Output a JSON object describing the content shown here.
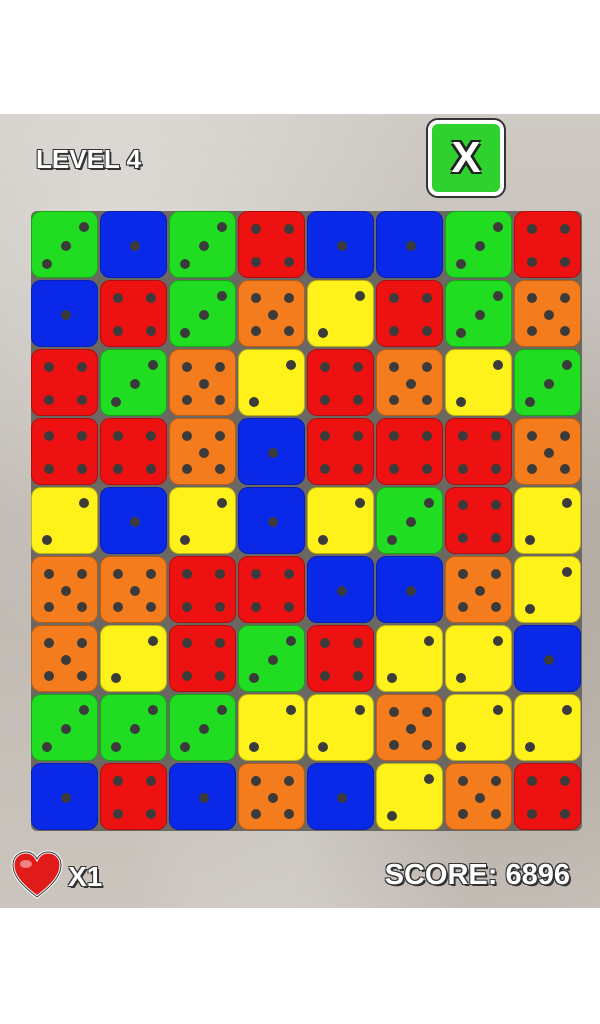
{
  "hud": {
    "level_label": "LEVEL 4",
    "close_label": "X",
    "lives_label": "X1",
    "score_label": "SCORE: 6896"
  },
  "colors": {
    "green": "#21dd21",
    "blue": "#0a28e8",
    "red": "#ee1111",
    "orange": "#f47c1c",
    "yellow": "#fff11a",
    "pip": "#3b3b3b",
    "heart": "#e11a1a"
  },
  "board": {
    "columns": 8,
    "rows": 9,
    "dice": [
      [
        {
          "color": "green",
          "value": 3
        },
        {
          "color": "blue",
          "value": 1
        },
        {
          "color": "green",
          "value": 3
        },
        {
          "color": "red",
          "value": 4
        },
        {
          "color": "blue",
          "value": 1
        },
        {
          "color": "blue",
          "value": 1
        },
        {
          "color": "green",
          "value": 3
        },
        {
          "color": "red",
          "value": 4
        }
      ],
      [
        {
          "color": "blue",
          "value": 1
        },
        {
          "color": "red",
          "value": 4
        },
        {
          "color": "green",
          "value": 3
        },
        {
          "color": "orange",
          "value": 5
        },
        {
          "color": "yellow",
          "value": 2
        },
        {
          "color": "red",
          "value": 4
        },
        {
          "color": "green",
          "value": 3
        },
        {
          "color": "orange",
          "value": 5
        }
      ],
      [
        {
          "color": "red",
          "value": 4
        },
        {
          "color": "green",
          "value": 3
        },
        {
          "color": "orange",
          "value": 5
        },
        {
          "color": "yellow",
          "value": 2
        },
        {
          "color": "red",
          "value": 4
        },
        {
          "color": "orange",
          "value": 5
        },
        {
          "color": "yellow",
          "value": 2
        },
        {
          "color": "green",
          "value": 3
        }
      ],
      [
        {
          "color": "red",
          "value": 4
        },
        {
          "color": "red",
          "value": 4
        },
        {
          "color": "orange",
          "value": 5
        },
        {
          "color": "blue",
          "value": 1
        },
        {
          "color": "red",
          "value": 4
        },
        {
          "color": "red",
          "value": 4
        },
        {
          "color": "red",
          "value": 4
        },
        {
          "color": "orange",
          "value": 5
        }
      ],
      [
        {
          "color": "yellow",
          "value": 2
        },
        {
          "color": "blue",
          "value": 1
        },
        {
          "color": "yellow",
          "value": 2
        },
        {
          "color": "blue",
          "value": 1
        },
        {
          "color": "yellow",
          "value": 2
        },
        {
          "color": "green",
          "value": 3
        },
        {
          "color": "red",
          "value": 4
        },
        {
          "color": "yellow",
          "value": 2
        }
      ],
      [
        {
          "color": "orange",
          "value": 5
        },
        {
          "color": "orange",
          "value": 5
        },
        {
          "color": "red",
          "value": 4
        },
        {
          "color": "red",
          "value": 4
        },
        {
          "color": "blue",
          "value": 1
        },
        {
          "color": "blue",
          "value": 1
        },
        {
          "color": "orange",
          "value": 5
        },
        {
          "color": "yellow",
          "value": 2
        }
      ],
      [
        {
          "color": "orange",
          "value": 5
        },
        {
          "color": "yellow",
          "value": 2
        },
        {
          "color": "red",
          "value": 4
        },
        {
          "color": "green",
          "value": 3
        },
        {
          "color": "red",
          "value": 4
        },
        {
          "color": "yellow",
          "value": 2
        },
        {
          "color": "yellow",
          "value": 2
        },
        {
          "color": "blue",
          "value": 1
        }
      ],
      [
        {
          "color": "green",
          "value": 3
        },
        {
          "color": "green",
          "value": 3
        },
        {
          "color": "green",
          "value": 3
        },
        {
          "color": "yellow",
          "value": 2
        },
        {
          "color": "yellow",
          "value": 2
        },
        {
          "color": "orange",
          "value": 5
        },
        {
          "color": "yellow",
          "value": 2
        },
        {
          "color": "yellow",
          "value": 2
        }
      ],
      [
        {
          "color": "blue",
          "value": 1
        },
        {
          "color": "red",
          "value": 4
        },
        {
          "color": "blue",
          "value": 1
        },
        {
          "color": "orange",
          "value": 5
        },
        {
          "color": "blue",
          "value": 1
        },
        {
          "color": "yellow",
          "value": 2
        },
        {
          "color": "orange",
          "value": 5
        },
        {
          "color": "red",
          "value": 4
        }
      ]
    ]
  },
  "icons": {
    "lives": "heart-icon",
    "close": "close-icon"
  }
}
